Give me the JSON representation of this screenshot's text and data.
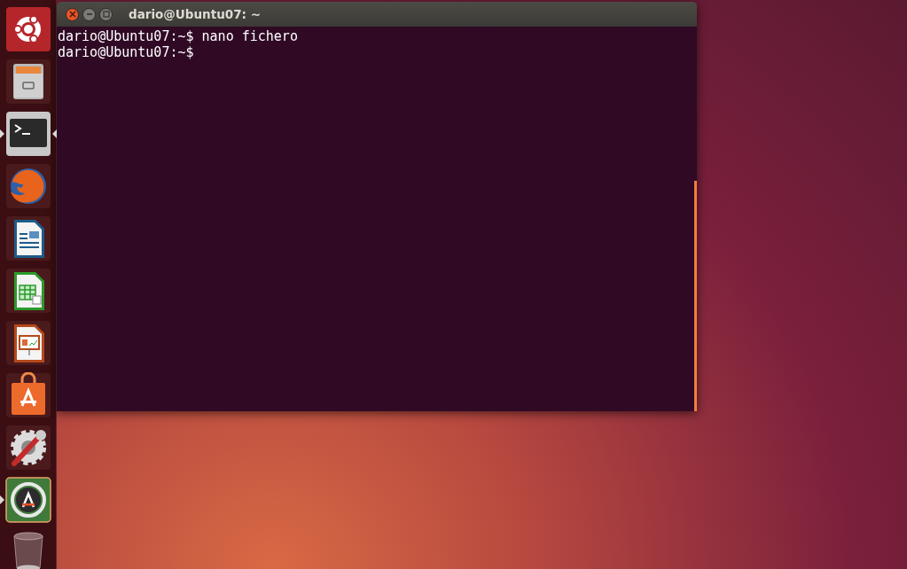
{
  "launcher": {
    "items": [
      {
        "kind": "dash",
        "running": false,
        "focused": false
      },
      {
        "kind": "files",
        "running": false,
        "focused": false
      },
      {
        "kind": "terminal",
        "running": true,
        "focused": true
      },
      {
        "kind": "browser",
        "running": false,
        "focused": false
      },
      {
        "kind": "writer",
        "running": false,
        "focused": false
      },
      {
        "kind": "calc",
        "running": false,
        "focused": false
      },
      {
        "kind": "impress",
        "running": false,
        "focused": false
      },
      {
        "kind": "store",
        "running": false,
        "focused": false
      },
      {
        "kind": "settings",
        "running": false,
        "focused": false
      },
      {
        "kind": "updater",
        "running": true,
        "focused": false
      },
      {
        "kind": "trash",
        "running": false,
        "focused": false
      }
    ]
  },
  "window": {
    "title": "dario@Ubuntu07: ~",
    "lines": [
      "dario@Ubuntu07:~$ nano fichero",
      "dario@Ubuntu07:~$"
    ]
  }
}
